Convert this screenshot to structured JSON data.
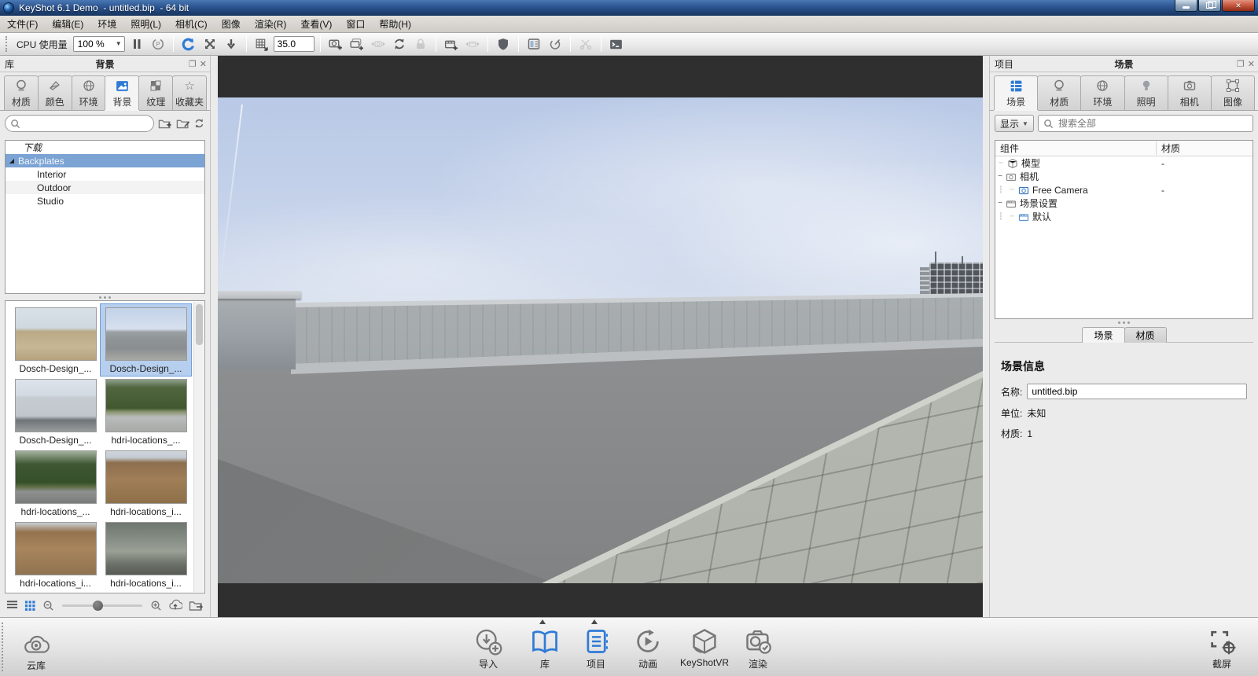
{
  "window": {
    "title": "KeyShot 6.1 Demo  - untitled.bip  - 64 bit"
  },
  "menu": {
    "items": [
      "文件(F)",
      "编辑(E)",
      "环境",
      "照明(L)",
      "相机(C)",
      "图像",
      "渲染(R)",
      "查看(V)",
      "窗口",
      "帮助(H)"
    ]
  },
  "toolbar": {
    "cpu_label": "CPU 使用量",
    "cpu_value": "100 %",
    "focal_length": "35.0"
  },
  "library": {
    "panel_label": "库",
    "title": "背景",
    "tabs": [
      "材质",
      "颜色",
      "环境",
      "背景",
      "纹理",
      "收藏夹"
    ],
    "active_tab": "背景",
    "search_placeholder": "",
    "tree": {
      "group_label": "下载",
      "items": [
        "Backplates",
        "Interior",
        "Outdoor",
        "Studio"
      ],
      "selected_item": "Backplates"
    },
    "thumbnails": [
      {
        "label": "Dosch-Design_..."
      },
      {
        "label": "Dosch-Design_...",
        "selected": true
      },
      {
        "label": "Dosch-Design_..."
      },
      {
        "label": "hdri-locations_..."
      },
      {
        "label": "hdri-locations_..."
      },
      {
        "label": "hdri-locations_i..."
      },
      {
        "label": "hdri-locations_i..."
      },
      {
        "label": "hdri-locations_i..."
      }
    ]
  },
  "project": {
    "panel_label": "项目",
    "title": "场景",
    "tabs": [
      "场景",
      "材质",
      "环境",
      "照明",
      "相机",
      "图像"
    ],
    "active_tab": "场景",
    "filter_label": "显示",
    "search_placeholder": "搜索全部",
    "tree": {
      "columns": [
        "组件",
        "材质"
      ],
      "rows": [
        {
          "label": "模型",
          "material": "-"
        },
        {
          "label": "相机",
          "material": ""
        },
        {
          "label": "Free Camera",
          "material": "-"
        },
        {
          "label": "场景设置",
          "material": ""
        },
        {
          "label": "默认",
          "material": ""
        }
      ]
    },
    "sub_tabs": [
      "场景",
      "材质"
    ],
    "active_sub_tab": "场景",
    "scene_info": {
      "heading": "场景信息",
      "name_label": "名称:",
      "name_value": "untitled.bip",
      "unit_label": "单位:",
      "unit_value": "未知",
      "materials_label": "材质:",
      "materials_value": "1"
    }
  },
  "dock": {
    "cloud_label": "云库",
    "items": [
      "导入",
      "库",
      "项目",
      "动画",
      "KeyShotVR",
      "渲染"
    ],
    "capture_label": "截屏"
  },
  "colors": {
    "accent_blue": "#2e7bd6",
    "selection_blue": "#7ba3d4",
    "titlebar_blue": "#2c5490"
  }
}
